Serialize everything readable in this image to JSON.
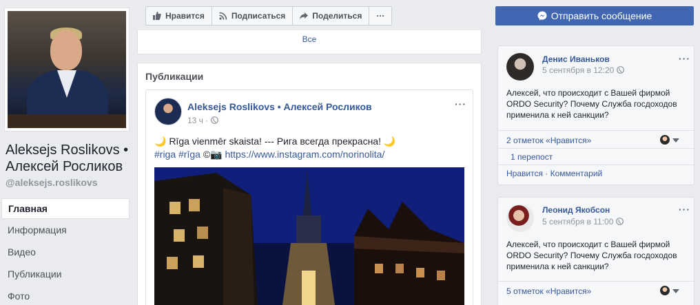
{
  "profile": {
    "name": "Aleksejs Roslikovs • Алексей Росликов",
    "handle": "@aleksejs.roslikovs"
  },
  "nav": {
    "items": [
      {
        "label": "Главная"
      },
      {
        "label": "Информация"
      },
      {
        "label": "Видео"
      },
      {
        "label": "Публикации"
      },
      {
        "label": "Фото"
      }
    ]
  },
  "actions": {
    "like": "Нравится",
    "follow": "Подписаться",
    "share": "Поделиться",
    "more": "···",
    "send_message": "Отправить сообщение"
  },
  "all_link": "Все",
  "publications": {
    "title": "Публикации",
    "post": {
      "author": "Aleksejs Roslikovs • Алексей Росликов",
      "time": "13 ч",
      "time_sep": "·",
      "line1": "🌙 Rīga vienmēr skaista! --- Рига всегда прекрасна! 🌙",
      "tags": "#riga #rīga",
      "copyright": "©📷",
      "url": "https://www.instagram.com/norinolita/"
    }
  },
  "comments": [
    {
      "name": "Денис Иваньков",
      "time": "5 сентября в 12:20",
      "text": "Алексей, что происходит с Вашей фирмой ORDO Security? Почему Служба госдоходов применила к ней санкции?",
      "likes": "2 отметок «Нравится»",
      "shares": "1 перепост",
      "like_action": "Нравится",
      "comment_action": "Комментарий"
    },
    {
      "name": "Леонид Якобсон",
      "time": "5 сентября в 11:00",
      "text": "Алексей, что происходит с Вашей фирмой ORDO Security? Почему Служба госдоходов применила к ней санкции?",
      "likes": "5 отметок «Нравится»"
    }
  ],
  "colors": {
    "brand_blue": "#4267b2",
    "link": "#365899",
    "background": "#e9ebee"
  }
}
